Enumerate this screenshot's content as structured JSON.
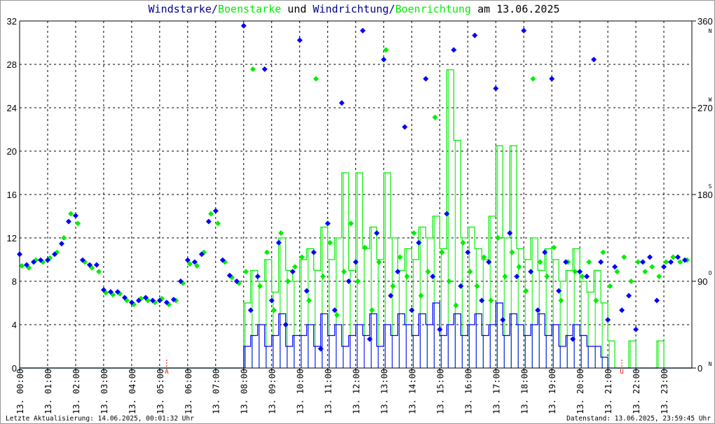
{
  "chart_data": {
    "type": "line",
    "title_parts": [
      {
        "text": "Windstarke",
        "color": "#00008b"
      },
      {
        "text": "/",
        "color": "#00008b"
      },
      {
        "text": "Boenstarke",
        "color": "#00ee00"
      },
      {
        "text": " und ",
        "color": "#000000"
      },
      {
        "text": "Windrichtung",
        "color": "#00008b"
      },
      {
        "text": "/",
        "color": "#00008b"
      },
      {
        "text": "Boenrichtung",
        "color": "#00ee00"
      },
      {
        "text": " am 13.06.2025",
        "color": "#000000"
      }
    ],
    "ylim": [
      0,
      32
    ],
    "yticks": [
      "0",
      "4",
      "8",
      "12",
      "16",
      "20",
      "24",
      "28",
      "32"
    ],
    "y2lim": [
      0,
      360
    ],
    "y2ticks": [
      {
        "value": "0",
        "dir": "N"
      },
      {
        "value": "90",
        "dir": "O"
      },
      {
        "value": "180",
        "dir": "S"
      },
      {
        "value": "270",
        "dir": "W"
      },
      {
        "value": "360",
        "dir": "N"
      }
    ],
    "xticks": [
      "13. 00:00",
      "13. 01:00",
      "13. 02:00",
      "13. 03:00",
      "13. 04:00",
      "13. 05:00",
      "13. 06:00",
      "13. 07:00",
      "13. 08:00",
      "13. 09:00",
      "13. 10:00",
      "13. 11:00",
      "13. 12:00",
      "13. 13:00",
      "13. 14:00",
      "13. 15:00",
      "13. 16:00",
      "13. 17:00",
      "13. 18:00",
      "13. 19:00",
      "13. 20:00",
      "13. 21:00",
      "13. 22:00",
      "13. 23:00"
    ],
    "grid": true,
    "markers": [
      {
        "label": "A",
        "hour": 5.25
      },
      {
        "label": "U",
        "hour": 21.5
      }
    ],
    "interval_minutes": 15,
    "series": [
      {
        "name": "Windstarke",
        "color": "#0000ff",
        "values": [
          0,
          0,
          0,
          0,
          0,
          0,
          0,
          0,
          0,
          0,
          0,
          0,
          0,
          0,
          0,
          0,
          0,
          0,
          0,
          0,
          0,
          0,
          0,
          0,
          0,
          0,
          0,
          0,
          0,
          0,
          0,
          0,
          2,
          3,
          4,
          2,
          3,
          5,
          2,
          3,
          3,
          4,
          2,
          5,
          3,
          4,
          2,
          3,
          4,
          3,
          5,
          2,
          4,
          3,
          5,
          4,
          3,
          5,
          4,
          6,
          3,
          4,
          5,
          3,
          4,
          5,
          3,
          4,
          6,
          3,
          5,
          4,
          3,
          4,
          5,
          3,
          4,
          2,
          3,
          4,
          3,
          2,
          2,
          1,
          0,
          0,
          0,
          0,
          0,
          0,
          0,
          0,
          0,
          0,
          0,
          0
        ]
      },
      {
        "name": "Boenstarke",
        "color": "#00ee00",
        "values": [
          0,
          0,
          0,
          0,
          0,
          0,
          0,
          0,
          0,
          0,
          0,
          0,
          0,
          0,
          0,
          0,
          0,
          0,
          0,
          0,
          0,
          0,
          0,
          0,
          0,
          0,
          0,
          0,
          0,
          0,
          0,
          0,
          6,
          9,
          8,
          10,
          7,
          12,
          9,
          8,
          10,
          11,
          9,
          13,
          10,
          12,
          18,
          9,
          18,
          11,
          13,
          10,
          18,
          12,
          9,
          11,
          10,
          13,
          12,
          14,
          11,
          27.5,
          21,
          12,
          13,
          11,
          10,
          14,
          20.5,
          12,
          20.5,
          11,
          10,
          12,
          9,
          11,
          10,
          8,
          9,
          11,
          8,
          7,
          9,
          6,
          2.5,
          0,
          0,
          2.5,
          0,
          0,
          0,
          2.5,
          0,
          0,
          0,
          0
        ]
      },
      {
        "name": "Windrichtung",
        "color": "#0000ff",
        "axis": "right",
        "values": [
          118,
          107,
          110,
          112,
          112,
          118,
          129,
          152,
          158,
          112,
          107,
          107,
          81,
          79,
          79,
          73,
          68,
          70,
          73,
          70,
          70,
          68,
          71,
          90,
          112,
          110,
          118,
          152,
          163,
          112,
          96,
          90,
          355,
          60,
          95,
          310,
          70,
          130,
          45,
          100,
          340,
          80,
          120,
          20,
          150,
          60,
          275,
          90,
          110,
          350,
          30,
          140,
          320,
          75,
          100,
          250,
          60,
          130,
          300,
          95,
          40,
          160,
          330,
          85,
          120,
          345,
          70,
          110,
          290,
          50,
          140,
          95,
          350,
          100,
          60,
          120,
          300,
          80,
          110,
          30,
          100,
          95,
          320,
          110,
          50,
          105,
          60,
          75,
          40,
          110,
          115,
          70,
          105,
          110,
          115,
          112
        ]
      },
      {
        "name": "Boenrichtung",
        "color": "#00ee00",
        "axis": "right",
        "values": [
          106,
          104,
          112,
          110,
          114,
          120,
          135,
          160,
          150,
          110,
          104,
          100,
          78,
          76,
          77,
          70,
          66,
          72,
          70,
          68,
          72,
          66,
          70,
          88,
          108,
          106,
          120,
          160,
          150,
          110,
          94,
          88,
          100,
          310,
          85,
          120,
          60,
          140,
          90,
          105,
          115,
          70,
          300,
          95,
          130,
          55,
          100,
          150,
          90,
          125,
          60,
          110,
          330,
          85,
          115,
          95,
          140,
          75,
          100,
          260,
          120,
          90,
          65,
          130,
          100,
          85,
          115,
          70,
          135,
          95,
          120,
          105,
          80,
          300,
          110,
          95,
          125,
          70,
          110,
          100,
          95,
          110,
          70,
          120,
          85,
          100,
          115,
          90,
          110,
          100,
          105,
          95,
          110,
          115,
          110,
          112
        ]
      }
    ]
  },
  "footer": {
    "left": "Letzte Aktualisierung: 14.06.2025, 00:01:32 Uhr",
    "right": "Datenstand: 13.06.2025, 23:59:45 Uhr"
  }
}
